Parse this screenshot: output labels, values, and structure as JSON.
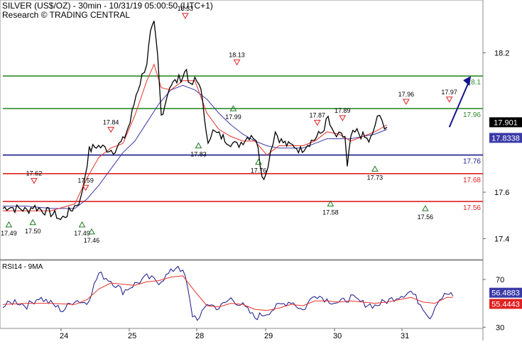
{
  "header": {
    "title": "SILVER (US$/OZ) - 30min - 10/31/19 05:00:50 (UTC+1)",
    "research": "Research © TRADING CENTRAL"
  },
  "colors": {
    "price": "#000000",
    "fast_ma": "#e8332a",
    "slow_ma": "#3a3aa8",
    "resistance": "#2e8b2e",
    "pivot": "#1a1a8c",
    "support": "#e02020",
    "arrow": "#14148c",
    "axis_bg": "#ffffff"
  },
  "chart_data": [
    {
      "type": "line",
      "name": "price",
      "title": "SILVER (US$/OZ) - 30min - 10/31/19 05:00:50 (UTC+1)",
      "x_labels": [
        "24",
        "25",
        "28",
        "29",
        "30",
        "31"
      ],
      "y_ticks": [
        17.4,
        17.6,
        18.2
      ],
      "ylim": [
        17.31,
        18.36
      ],
      "close_path": [
        [
          0,
          17.53
        ],
        [
          0.5,
          17.54
        ],
        [
          1,
          17.53
        ],
        [
          1.5,
          17.53
        ],
        [
          2,
          17.52
        ],
        [
          2.5,
          17.54
        ],
        [
          3,
          17.53
        ],
        [
          3.5,
          17.52
        ],
        [
          4,
          17.51
        ],
        [
          4.5,
          17.5
        ],
        [
          4.8,
          17.48
        ],
        [
          5.2,
          17.5
        ],
        [
          5.8,
          17.53
        ],
        [
          6.5,
          17.57
        ],
        [
          7.2,
          17.78
        ],
        [
          7.8,
          17.8
        ],
        [
          8.5,
          17.79
        ],
        [
          9.2,
          17.78
        ],
        [
          10,
          17.82
        ],
        [
          10.6,
          17.9
        ],
        [
          11.1,
          18.02
        ],
        [
          11.6,
          18.1
        ],
        [
          12.0,
          18.16
        ],
        [
          12.3,
          18.28
        ],
        [
          12.6,
          18.32
        ],
        [
          12.9,
          18.18
        ],
        [
          13.2,
          17.93
        ],
        [
          13.5,
          17.98
        ],
        [
          13.9,
          18.06
        ],
        [
          14.5,
          18.08
        ],
        [
          15,
          18.1
        ],
        [
          15.3,
          18.13
        ],
        [
          15.6,
          18.05
        ],
        [
          16,
          18.08
        ],
        [
          16.5,
          18.06
        ],
        [
          16.8,
          17.9
        ],
        [
          17.1,
          17.83
        ],
        [
          17.5,
          17.86
        ],
        [
          18.2,
          17.84
        ],
        [
          18.8,
          17.82
        ],
        [
          19.5,
          17.8
        ],
        [
          20.2,
          17.83
        ],
        [
          20.7,
          17.85
        ],
        [
          21.1,
          17.83
        ],
        [
          21.6,
          17.68
        ],
        [
          21.9,
          17.67
        ],
        [
          22.3,
          17.78
        ],
        [
          22.7,
          17.86
        ],
        [
          23.2,
          17.82
        ],
        [
          23.8,
          17.8
        ],
        [
          24.3,
          17.8
        ],
        [
          24.8,
          17.78
        ],
        [
          25.4,
          17.81
        ],
        [
          26,
          17.83
        ],
        [
          26.6,
          17.86
        ],
        [
          27.1,
          17.92
        ],
        [
          27.4,
          17.86
        ],
        [
          27.8,
          17.84
        ],
        [
          28.2,
          17.84
        ],
        [
          28.5,
          17.84
        ],
        [
          28.7,
          17.7
        ],
        [
          29,
          17.84
        ],
        [
          29.5,
          17.86
        ],
        [
          30,
          17.84
        ],
        [
          30.5,
          17.82
        ],
        [
          30.8,
          17.84
        ],
        [
          31.2,
          17.93
        ],
        [
          31.6,
          17.9
        ],
        [
          32.0,
          17.88
        ]
      ],
      "series": [
        {
          "name": "MA fast",
          "points": [
            [
              0,
              17.52
            ],
            [
              2,
              17.52
            ],
            [
              4,
              17.52
            ],
            [
              6,
              17.55
            ],
            [
              7,
              17.66
            ],
            [
              8,
              17.75
            ],
            [
              9,
              17.79
            ],
            [
              10,
              17.81
            ],
            [
              11,
              17.93
            ],
            [
              12,
              18.08
            ],
            [
              12.6,
              18.15
            ],
            [
              13.2,
              18.05
            ],
            [
              14,
              18.04
            ],
            [
              15,
              18.08
            ],
            [
              16,
              18.08
            ],
            [
              17,
              17.94
            ],
            [
              18,
              17.87
            ],
            [
              19,
              17.84
            ],
            [
              20,
              17.82
            ],
            [
              21,
              17.82
            ],
            [
              22,
              17.76
            ],
            [
              23,
              17.8
            ],
            [
              24,
              17.8
            ],
            [
              25,
              17.8
            ],
            [
              26,
              17.82
            ],
            [
              27,
              17.86
            ],
            [
              28,
              17.85
            ],
            [
              29,
              17.82
            ],
            [
              30,
              17.84
            ],
            [
              31,
              17.86
            ],
            [
              32,
              17.89
            ]
          ]
        },
        {
          "name": "MA slow",
          "points": [
            [
              0,
              17.54
            ],
            [
              2,
              17.54
            ],
            [
              4,
              17.53
            ],
            [
              6,
              17.53
            ],
            [
              7,
              17.57
            ],
            [
              8,
              17.63
            ],
            [
              9,
              17.7
            ],
            [
              10,
              17.77
            ],
            [
              11,
              17.82
            ],
            [
              12,
              17.9
            ],
            [
              13,
              17.98
            ],
            [
              14,
              18.04
            ],
            [
              15,
              18.06
            ],
            [
              16,
              18.04
            ],
            [
              17,
              18.0
            ],
            [
              18,
              17.94
            ],
            [
              19,
              17.89
            ],
            [
              20,
              17.85
            ],
            [
              21,
              17.82
            ],
            [
              22,
              17.8
            ],
            [
              23,
              17.79
            ],
            [
              24,
              17.79
            ],
            [
              25,
              17.79
            ],
            [
              26,
              17.81
            ],
            [
              27,
              17.83
            ],
            [
              28,
              17.83
            ],
            [
              29,
              17.83
            ],
            [
              30,
              17.84
            ],
            [
              31,
              17.85
            ],
            [
              32,
              17.87
            ]
          ]
        }
      ],
      "levels": [
        {
          "value": 18.1,
          "label": "18.1",
          "role": "resistance"
        },
        {
          "value": 17.96,
          "label": "17.96",
          "role": "resistance"
        },
        {
          "value": 17.76,
          "label": "17.76",
          "role": "pivot"
        },
        {
          "value": 17.68,
          "label": "17.68",
          "role": "support"
        },
        {
          "value": 17.56,
          "label": "17.56",
          "role": "support"
        }
      ],
      "price_tags": [
        {
          "value": 17.901,
          "label": "17.901",
          "role": "last"
        },
        {
          "value": 17.8338,
          "label": "17.8338",
          "role": "slow_ma"
        }
      ],
      "swing_labels": [
        {
          "x": 0.5,
          "value": 17.49,
          "label": "17.49",
          "kind": "low"
        },
        {
          "x": 2.5,
          "value": 17.5,
          "label": "17.50",
          "kind": "low"
        },
        {
          "x": 2.6,
          "value": 17.62,
          "label": "17.62",
          "kind": "high"
        },
        {
          "x": 6.6,
          "value": 17.49,
          "label": "17.49",
          "kind": "low"
        },
        {
          "x": 6.9,
          "value": 17.59,
          "label": "17.59",
          "kind": "high"
        },
        {
          "x": 7.4,
          "value": 17.46,
          "label": "17.46",
          "kind": "low"
        },
        {
          "x": 9.0,
          "value": 17.84,
          "label": "17.84",
          "kind": "high"
        },
        {
          "x": 15.2,
          "value": 18.33,
          "label": "18.33",
          "kind": "high"
        },
        {
          "x": 16.3,
          "value": 17.83,
          "label": "17.83",
          "kind": "low"
        },
        {
          "x": 19.5,
          "value": 18.13,
          "label": "18.13",
          "kind": "high"
        },
        {
          "x": 19.2,
          "value": 17.99,
          "label": "17.99",
          "kind": "low"
        },
        {
          "x": 21.3,
          "value": 17.76,
          "label": "17.76",
          "kind": "low"
        },
        {
          "x": 26.2,
          "value": 17.87,
          "label": "17.87",
          "kind": "high"
        },
        {
          "x": 27.3,
          "value": 17.58,
          "label": "17.58",
          "kind": "low"
        },
        {
          "x": 28.3,
          "value": 17.89,
          "label": "17.89",
          "kind": "high"
        },
        {
          "x": 31.0,
          "value": 17.73,
          "label": "17.73",
          "kind": "low"
        },
        {
          "x": 33.6,
          "value": 17.96,
          "label": "17.96",
          "kind": "high"
        },
        {
          "x": 35.2,
          "value": 17.56,
          "label": "17.56",
          "kind": "low"
        },
        {
          "x": 37.2,
          "value": 17.97,
          "label": "17.97",
          "kind": "high"
        }
      ],
      "forecast_arrow": {
        "from": [
          37.2,
          17.88
        ],
        "to": [
          39.0,
          18.1
        ]
      }
    },
    {
      "type": "line",
      "title": "RSI14 - 9MA",
      "y_ticks": [
        30,
        70
      ],
      "ylim": [
        29,
        86
      ],
      "series": [
        {
          "name": "RSI14",
          "points": [
            [
              0,
              47
            ],
            [
              1,
              52
            ],
            [
              2,
              48
            ],
            [
              3,
              55
            ],
            [
              4,
              50
            ],
            [
              5,
              44
            ],
            [
              6,
              53
            ],
            [
              7,
              50
            ],
            [
              8,
              75
            ],
            [
              9,
              69
            ],
            [
              10,
              60
            ],
            [
              11,
              66
            ],
            [
              12,
              72
            ],
            [
              13,
              68
            ],
            [
              14,
              76
            ],
            [
              14.6,
              82
            ],
            [
              15.2,
              72
            ],
            [
              15.8,
              40
            ],
            [
              16.4,
              37
            ],
            [
              17,
              50
            ],
            [
              18,
              46
            ],
            [
              19,
              54
            ],
            [
              20,
              48
            ],
            [
              21,
              38
            ],
            [
              22,
              42
            ],
            [
              23,
              48
            ],
            [
              24,
              52
            ],
            [
              25,
              44
            ],
            [
              26,
              58
            ],
            [
              27,
              53
            ],
            [
              28,
              50
            ],
            [
              29,
              55
            ],
            [
              30,
              50
            ],
            [
              31,
              48
            ],
            [
              32,
              52
            ],
            [
              33,
              56
            ],
            [
              34,
              60
            ],
            [
              35,
              47
            ],
            [
              35.6,
              38
            ],
            [
              36.2,
              52
            ],
            [
              37,
              58
            ],
            [
              37.5,
              56
            ]
          ]
        },
        {
          "name": "9MA",
          "points": [
            [
              0,
              49
            ],
            [
              2,
              50
            ],
            [
              4,
              50
            ],
            [
              6,
              49
            ],
            [
              7,
              53
            ],
            [
              8,
              62
            ],
            [
              9,
              67
            ],
            [
              10,
              66
            ],
            [
              11,
              65
            ],
            [
              12,
              68
            ],
            [
              13,
              69
            ],
            [
              14,
              72
            ],
            [
              15,
              73
            ],
            [
              16,
              60
            ],
            [
              17,
              48
            ],
            [
              18,
              47
            ],
            [
              19,
              50
            ],
            [
              20,
              49
            ],
            [
              21,
              45
            ],
            [
              22,
              44
            ],
            [
              23,
              46
            ],
            [
              24,
              49
            ],
            [
              25,
              48
            ],
            [
              26,
              52
            ],
            [
              27,
              52
            ],
            [
              28,
              51
            ],
            [
              29,
              52
            ],
            [
              30,
              51
            ],
            [
              31,
              50
            ],
            [
              32,
              51
            ],
            [
              33,
              53
            ],
            [
              34,
              55
            ],
            [
              35,
              51
            ],
            [
              36,
              50
            ],
            [
              37,
              55
            ],
            [
              37.5,
              55
            ]
          ]
        }
      ],
      "value_tags": [
        {
          "value": 56.4883,
          "label": "56.4883",
          "role": "rsi"
        },
        {
          "value": 55.4443,
          "label": "55.4443",
          "role": "ma"
        }
      ]
    }
  ]
}
